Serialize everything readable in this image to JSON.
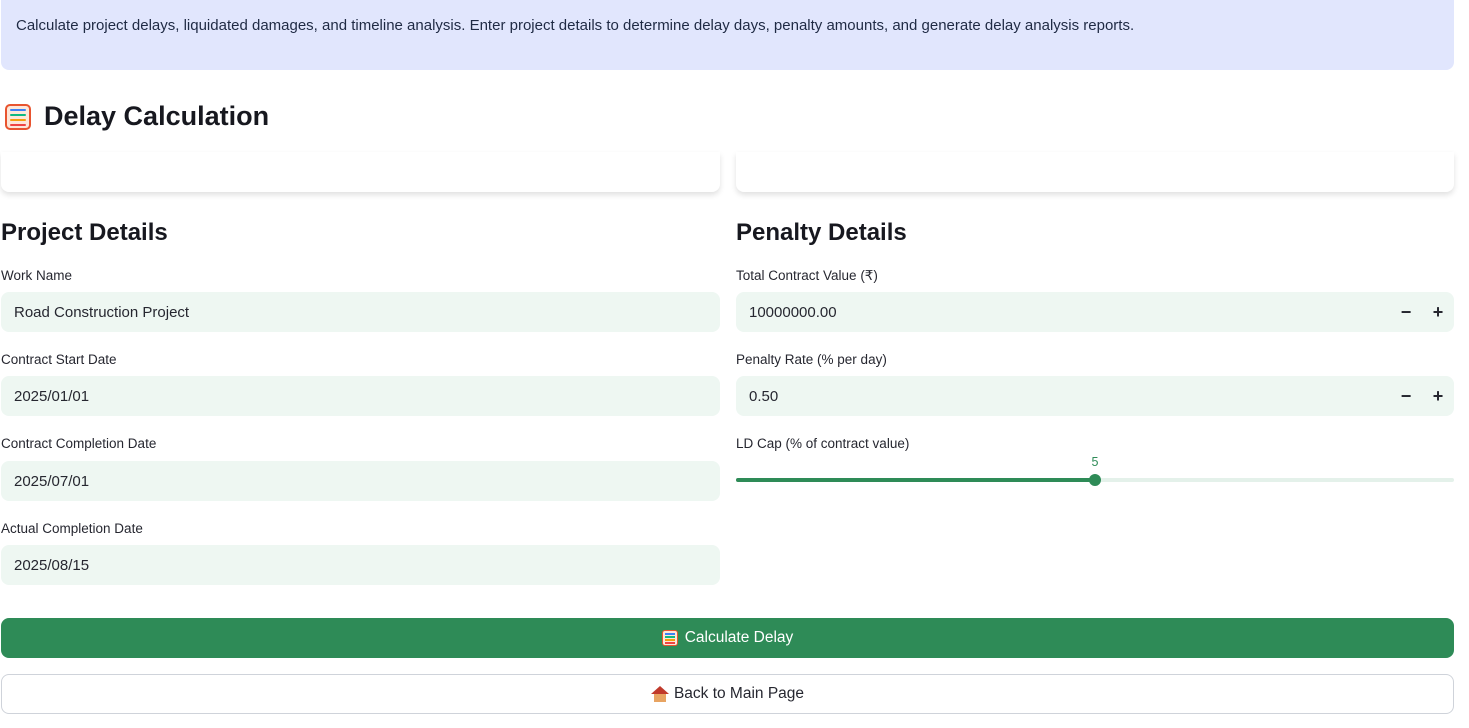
{
  "info": {
    "text": "Calculate project delays, liquidated damages, and timeline analysis. Enter project details to determine delay days, penalty amounts, and generate delay analysis reports."
  },
  "page": {
    "title": "Delay Calculation",
    "title_icon": "abacus-icon"
  },
  "project": {
    "title": "Project Details",
    "work_name_label": "Work Name",
    "work_name_value": "Road Construction Project",
    "start_label": "Contract Start Date",
    "start_value": "2025/01/01",
    "completion_label": "Contract Completion Date",
    "completion_value": "2025/07/01",
    "actual_label": "Actual Completion Date",
    "actual_value": "2025/08/15"
  },
  "penalty": {
    "title": "Penalty Details",
    "contract_label": "Total Contract Value (₹)",
    "contract_value": "10000000.00",
    "rate_label": "Penalty Rate (% per day)",
    "rate_value": "0.50",
    "cap_label": "LD Cap (% of contract value)",
    "cap_value": "5",
    "cap_fraction": 0.5,
    "minus": "−",
    "plus": "+"
  },
  "actions": {
    "calculate_label": "Calculate Delay",
    "back_label": "Back to Main Page"
  },
  "colors": {
    "accent": "#2e8b57",
    "info_bg": "#e1e6fd",
    "field_bg": "#eef7f2"
  }
}
